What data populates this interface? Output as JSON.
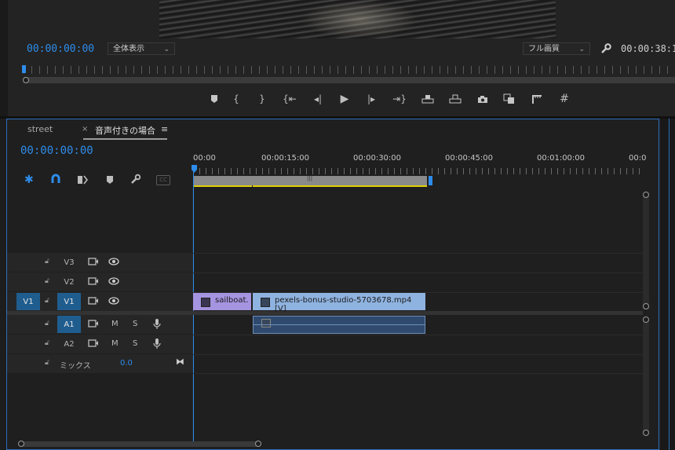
{
  "monitor": {
    "timecode": "00:00:00:00",
    "zoom_select": "全体表示",
    "quality_select": "フル画質",
    "duration": "00:00:38:1"
  },
  "transport": {
    "icons": [
      "marker-icon",
      "mark-in-icon",
      "mark-out-icon",
      "go-to-in-icon",
      "step-back-icon",
      "play-icon",
      "step-forward-icon",
      "go-to-out-icon",
      "lift-icon",
      "extract-icon",
      "export-frame-icon",
      "compare-icon",
      "trim-icon",
      "grid-icon"
    ]
  },
  "timeline": {
    "tabs": [
      {
        "label": "street"
      },
      {
        "label": "音声付きの場合"
      }
    ],
    "close_glyph": "×",
    "menu_glyph": "≡",
    "timecode": "00:00:00:00",
    "ruler": [
      "00:00",
      "00:00:15:00",
      "00:00:30:00",
      "00:00:45:00",
      "00:01:00:00",
      "00:0"
    ],
    "tracks": {
      "video": [
        {
          "name": "V3"
        },
        {
          "name": "V2"
        },
        {
          "name": "V1",
          "source": "V1"
        }
      ],
      "audio": [
        {
          "name": "A1",
          "m": "M",
          "s": "S"
        },
        {
          "name": "A2",
          "m": "M",
          "s": "S"
        }
      ],
      "mix": {
        "label": "ミックス",
        "value": "0.0"
      }
    },
    "clips": {
      "sailboat": "sailboat.",
      "pexels": "pexels-bonus-studio-5703678.mp4 [V]"
    },
    "work_area_glyph": "|||"
  },
  "colors": {
    "accent": "#2d8ceb",
    "clip_purple": "#a594e0",
    "clip_blue": "#8fb3e0",
    "audio_clip": "#2f4a6e",
    "work_area_yellow": "#e1d000"
  }
}
